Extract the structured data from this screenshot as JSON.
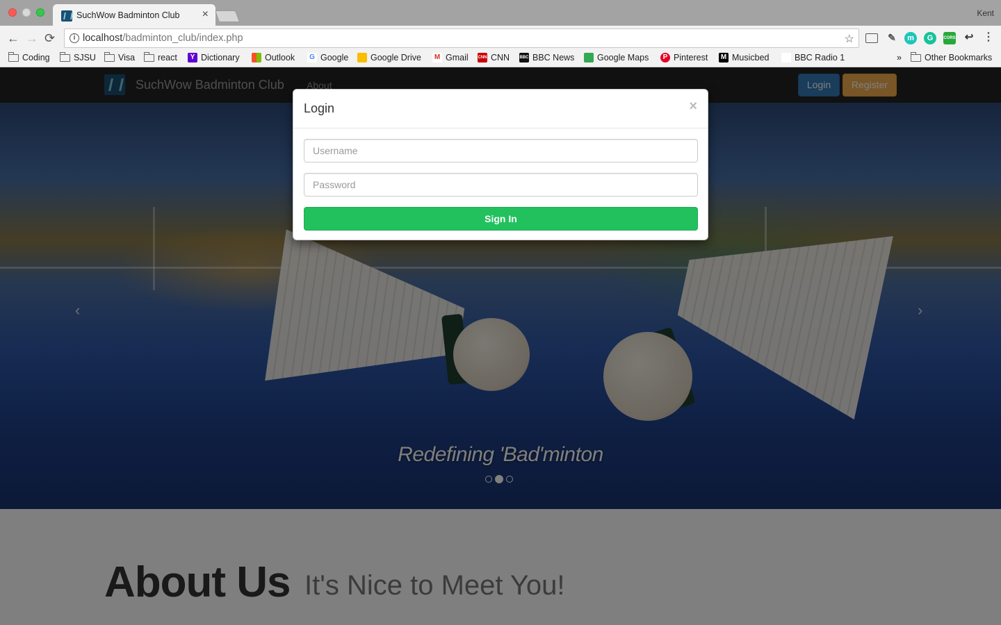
{
  "browser": {
    "tab_title": "SuchWow Badminton Club",
    "tab_close": "×",
    "profile_name": "Kent",
    "url_host": "localhost",
    "url_path": "/badminton_club/index.php",
    "back": "←",
    "forward": "→",
    "reload": "⟳",
    "info": "i",
    "star": "☆",
    "extensions": [
      "m",
      "G",
      "CORS"
    ],
    "menu": "⋮",
    "bookmarks": [
      {
        "label": "Coding",
        "icon": "folder"
      },
      {
        "label": "SJSU",
        "icon": "folder"
      },
      {
        "label": "Visa",
        "icon": "folder"
      },
      {
        "label": "react",
        "icon": "folder"
      },
      {
        "label": "Dictionary",
        "icon": "Y"
      },
      {
        "label": "Outlook",
        "icon": "ms"
      },
      {
        "label": "Google",
        "icon": "G"
      },
      {
        "label": "Google Drive",
        "icon": "drive"
      },
      {
        "label": "Gmail",
        "icon": "M"
      },
      {
        "label": "CNN",
        "icon": "CNN"
      },
      {
        "label": "BBC News",
        "icon": "BBC"
      },
      {
        "label": "Google Maps",
        "icon": "maps"
      },
      {
        "label": "Pinterest",
        "icon": "P"
      },
      {
        "label": "Musicbed",
        "icon": "M"
      },
      {
        "label": "BBC Radio 1",
        "icon": "play"
      }
    ],
    "bookmarks_overflow": "»",
    "other_bookmarks": "Other Bookmarks"
  },
  "site": {
    "brand": "SuchWow Badminton Club",
    "nav_about": "About",
    "login_button": "Login",
    "register_button": "Register",
    "carousel_caption": "Redefining 'Bad'minton",
    "carousel_prev": "‹",
    "carousel_next": "›",
    "active_slide": 2,
    "slide_count": 3,
    "about_title": "About Us",
    "about_subtitle": "It's Nice to Meet You!"
  },
  "modal": {
    "title": "Login",
    "close": "×",
    "username_placeholder": "Username",
    "password_placeholder": "Password",
    "submit": "Sign In"
  },
  "colors": {
    "primary": "#337ab7",
    "warning": "#f0ad4e",
    "success": "#22c15e",
    "navbar": "#222222"
  }
}
